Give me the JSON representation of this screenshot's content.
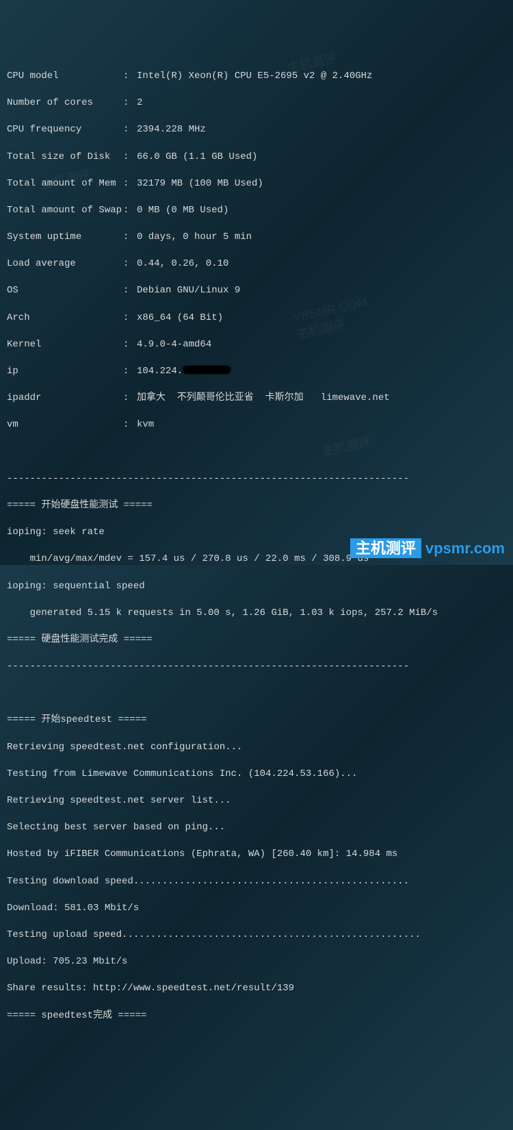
{
  "sysinfo": {
    "cpu_model_label": "CPU model",
    "cpu_model": "Intel(R) Xeon(R) CPU E5-2695 v2 @ 2.40GHz",
    "cores_label": "Number of cores",
    "cores": "2",
    "freq_label": "CPU frequency",
    "freq": "2394.228 MHz",
    "disk_label": "Total size of Disk",
    "disk": "66.0 GB (1.1 GB Used)",
    "mem_label": "Total amount of Mem",
    "mem": "32179 MB (100 MB Used)",
    "swap_label": "Total amount of Swap",
    "swap": "0 MB (0 MB Used)",
    "uptime_label": "System uptime",
    "uptime": "0 days, 0 hour 5 min",
    "load_label": "Load average",
    "load": "0.44, 0.26, 0.10",
    "os_label": "OS",
    "os": "Debian GNU/Linux 9",
    "arch_label": "Arch",
    "arch": "x86_64 (64 Bit)",
    "kernel_label": "Kernel",
    "kernel": "4.9.0-4-amd64",
    "ip_label": "ip",
    "ip": "104.224.",
    "ipaddr_label": "ipaddr",
    "ipaddr": "加拿大  不列颠哥伦比亚省  卡斯尔加   limewave.net",
    "vm_label": "vm",
    "vm": "kvm",
    "colon": ":"
  },
  "divider": "----------------------------------------------------------------------",
  "disk_test": {
    "header": "===== 开始硬盘性能测试 =====",
    "line1": "ioping: seek rate",
    "line2": "    min/avg/max/mdev = 157.4 us / 270.8 us / 22.0 ms / 308.9 us",
    "line3": "ioping: sequential speed",
    "line4": "    generated 5.15 k requests in 5.00 s, 1.26 GiB, 1.03 k iops, 257.2 MiB/s",
    "footer": "===== 硬盘性能测试完成 ====="
  },
  "speedtest": {
    "header": "===== 开始speedtest =====",
    "line1": "Retrieving speedtest.net configuration...",
    "line2": "Testing from Limewave Communications Inc. (104.224.53.166)...",
    "line3": "Retrieving speedtest.net server list...",
    "line4": "Selecting best server based on ping...",
    "line5": "Hosted by iFIBER Communications (Ephrata, WA) [260.40 km]: 14.984 ms",
    "line6": "Testing download speed................................................",
    "line7": "Download: 581.03 Mbit/s",
    "line8": "Testing upload speed....................................................",
    "line9": "Upload: 705.23 Mbit/s",
    "line10": "Share results: http://www.speedtest.net/result/139",
    "footer": "===== speedtest完成 ====="
  },
  "watermark": {
    "zh": "主机测评",
    "en": "vpsmr.com"
  }
}
